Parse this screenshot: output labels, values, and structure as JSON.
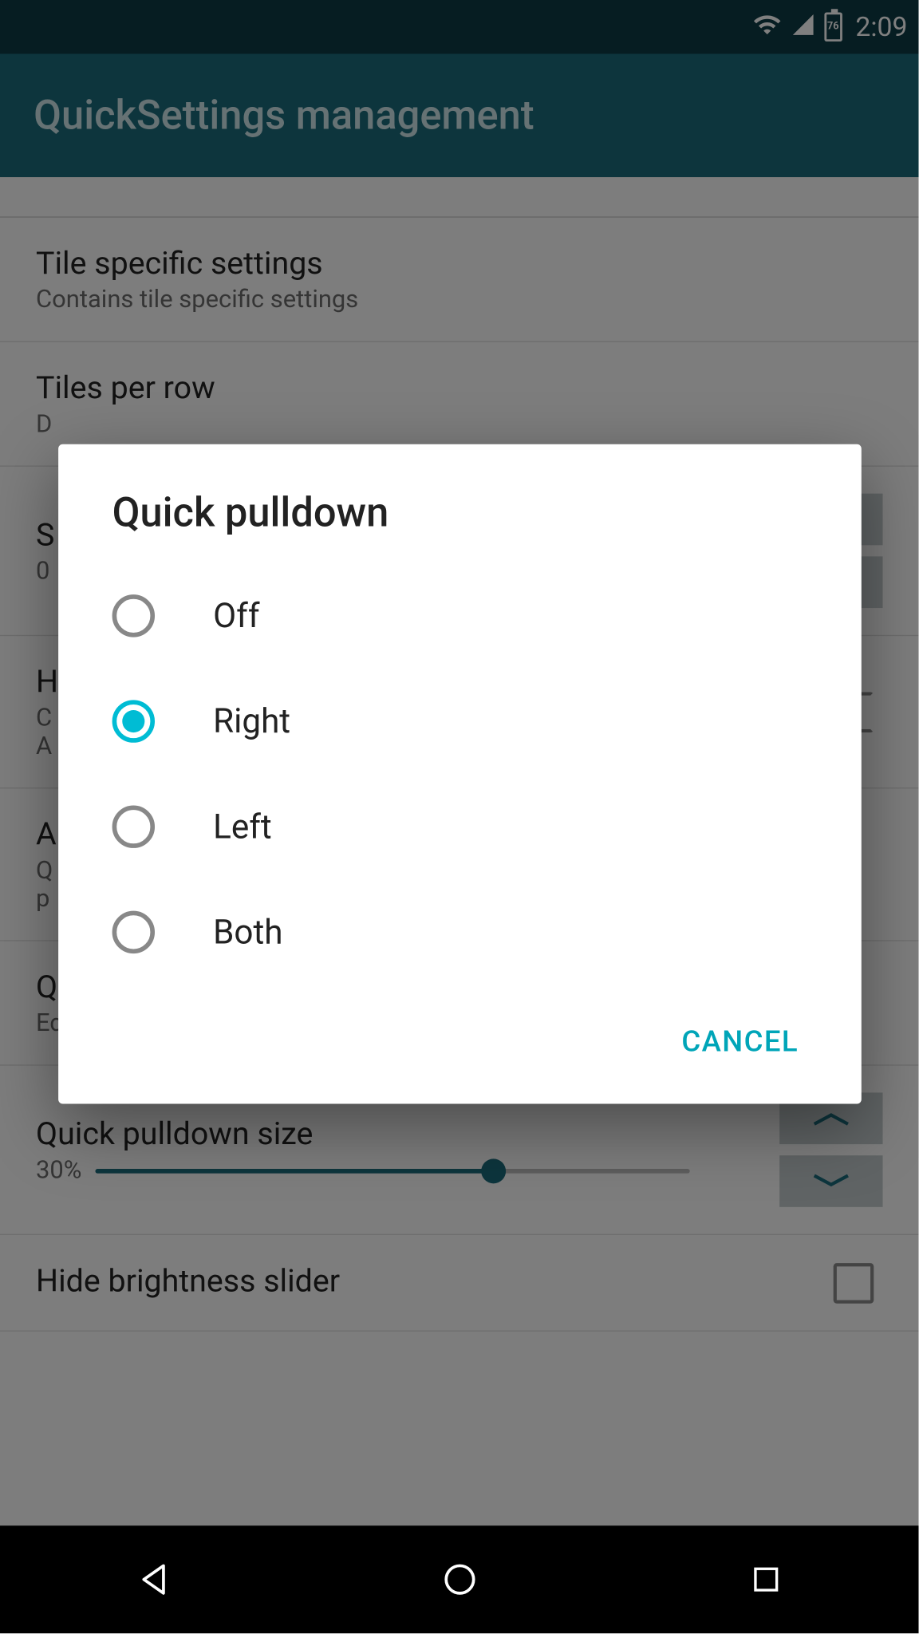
{
  "status": {
    "battery_level": "76",
    "time": "2:09"
  },
  "app_bar": {
    "title": "QuickSettings management"
  },
  "settings": {
    "tile_specific": {
      "title": "Tile specific settings",
      "subtitle": "Contains tile specific settings"
    },
    "tiles_per_row": {
      "title": "Tiles per row",
      "subtitle": "D"
    },
    "item_s": {
      "title": "S",
      "subtitle": "0"
    },
    "item_h": {
      "title": "H",
      "subtitle_line1": "C",
      "subtitle_line2": "A"
    },
    "item_a": {
      "title": "A",
      "subtitle_line1": "Q",
      "subtitle_line2": "p"
    },
    "quick_pulldown": {
      "title": "Quick pulldown",
      "subtitle": "Edge of the status bar pulls down QuickSettings"
    },
    "pulldown_size": {
      "title": "Quick pulldown size",
      "value": "30%",
      "slider_pct": 67
    },
    "hide_brightness": {
      "title": "Hide brightness slider"
    }
  },
  "dialog": {
    "title": "Quick pulldown",
    "options": {
      "off": "Off",
      "right": "Right",
      "left": "Left",
      "both": "Both"
    },
    "selected": "right",
    "cancel": "CANCEL"
  }
}
